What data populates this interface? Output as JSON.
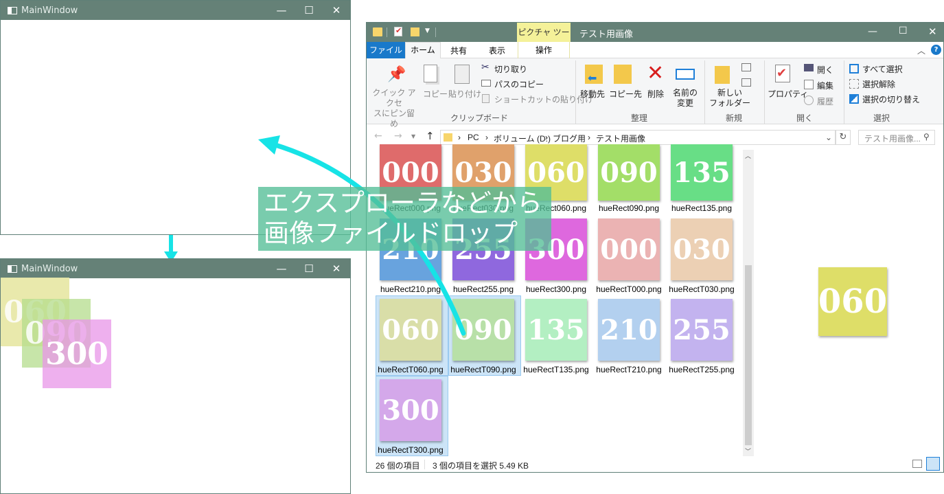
{
  "win1": {
    "title": "MainWindow"
  },
  "win2": {
    "title": "MainWindow"
  },
  "win_controls": {
    "min": "—",
    "max": "☐",
    "close": "✕"
  },
  "dropped": [
    {
      "label": "060",
      "color": "#e8e8a8"
    },
    {
      "label": "090",
      "color": "#cbe6a8"
    },
    {
      "label": "300",
      "color": "#eeaaea"
    }
  ],
  "annotation": {
    "line1": "エクスプローラなどから",
    "line2": "画像ファイルドロップ"
  },
  "explorer": {
    "title": "テスト用画像",
    "context_tab": "ピクチャ ツール",
    "tabs": [
      "ファイル",
      "ホーム",
      "共有",
      "表示",
      "操作"
    ],
    "ribbon": {
      "pin": "クイック アクセスにピン留め",
      "pin_l1": "クイック アクセ",
      "pin_l2": "スにピン留め",
      "copy": "コピー",
      "paste": "貼り付け",
      "cut": "切り取り",
      "copy_path": "パスのコピー",
      "paste_shortcut": "ショートカットの貼り付け",
      "group_clipboard": "クリップボード",
      "move_to": "移動先",
      "copy_to": "コピー先",
      "delete": "削除",
      "rename_l1": "名前の",
      "rename_l2": "変更",
      "group_organize": "整理",
      "new_folder_l1": "新しい",
      "new_folder_l2": "フォルダー",
      "group_new": "新規",
      "properties": "プロパティ",
      "open": "開く",
      "edit": "編集",
      "history": "履歴",
      "group_open": "開く",
      "select_all": "すべて選択",
      "select_none": "選択解除",
      "invert": "選択の切り替え",
      "group_select": "選択"
    },
    "breadcrumb": [
      "PC",
      "ボリューム (D:)",
      "ブログ用",
      "テスト用画像"
    ],
    "search_placeholder": "テスト用画像...",
    "files": [
      {
        "label": "000",
        "name": "hueRect000.png",
        "color": "#df6b6b"
      },
      {
        "label": "030",
        "name": "hueRect030.png",
        "color": "#e0a16b"
      },
      {
        "label": "060",
        "name": "hueRect060.png",
        "color": "#dede68"
      },
      {
        "label": "090",
        "name": "hueRect090.png",
        "color": "#a3de68"
      },
      {
        "label": "135",
        "name": "hueRect135.png",
        "color": "#68de86"
      },
      {
        "label": "210",
        "name": "hueRect210.png",
        "color": "#68a3de"
      },
      {
        "label": "255",
        "name": "hueRect255.png",
        "color": "#8f68de"
      },
      {
        "label": "300",
        "name": "hueRect300.png",
        "color": "#de68de"
      },
      {
        "label": "000",
        "name": "hueRectT000.png",
        "color": "#ebb3b3"
      },
      {
        "label": "030",
        "name": "hueRectT030.png",
        "color": "#ecd0b4"
      },
      {
        "label": "060",
        "name": "hueRectT060.png",
        "color": "#d9dea8"
      },
      {
        "label": "090",
        "name": "hueRectT090.png",
        "color": "#b8e0a8"
      },
      {
        "label": "135",
        "name": "hueRectT135.png",
        "color": "#b3efc2"
      },
      {
        "label": "210",
        "name": "hueRectT210.png",
        "color": "#b3d0ef"
      },
      {
        "label": "255",
        "name": "hueRectT255.png",
        "color": "#c3b3ef"
      },
      {
        "label": "300",
        "name": "hueRectT300.png",
        "color": "#d4a8ea"
      }
    ],
    "preview": {
      "label": "060",
      "color": "#dede68"
    },
    "status": {
      "count": "26 個の項目",
      "selection": "3 個の項目を選択  5.49 KB"
    }
  }
}
